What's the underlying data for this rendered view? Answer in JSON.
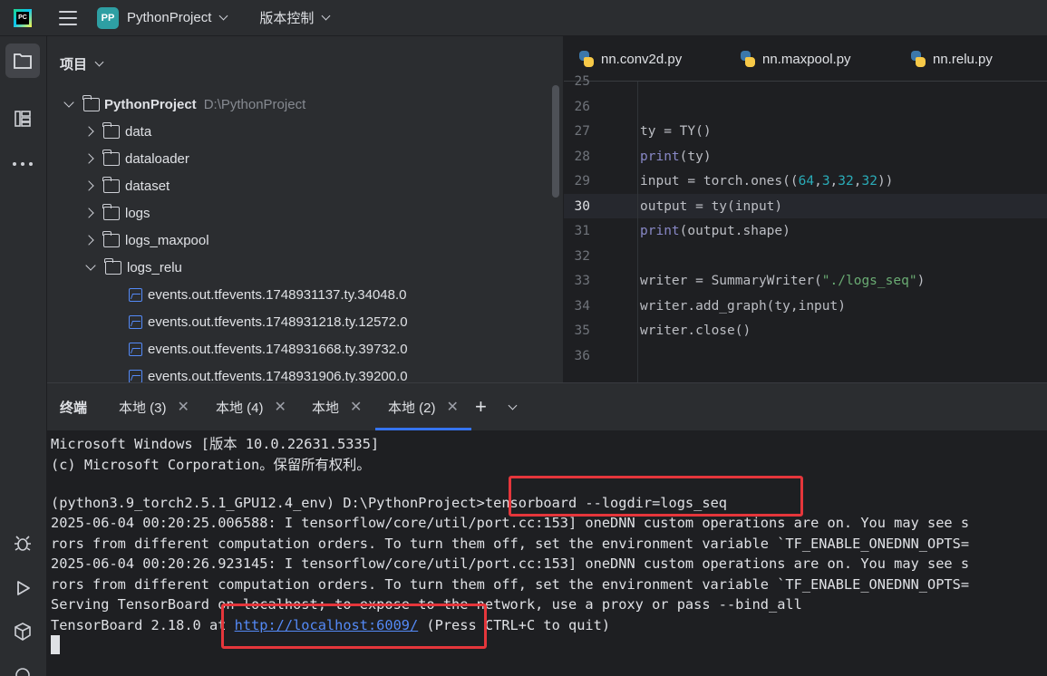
{
  "titlebar": {
    "logo_text": "PC",
    "project_badge": "PP",
    "project_name": "PythonProject",
    "vcs_label": "版本控制"
  },
  "project_panel": {
    "title": "项目",
    "root": {
      "name": "PythonProject",
      "path": "D:\\PythonProject"
    },
    "folders": [
      "data",
      "dataloader",
      "dataset",
      "logs",
      "logs_maxpool",
      "logs_relu"
    ],
    "files": [
      "events.out.tfevents.1748931137.ty.34048.0",
      "events.out.tfevents.1748931218.ty.12572.0",
      "events.out.tfevents.1748931668.ty.39732.0",
      "events.out.tfevents.1748931906.ty.39200.0"
    ]
  },
  "editor": {
    "tabs": [
      "nn.conv2d.py",
      "nn.maxpool.py",
      "nn.relu.py"
    ],
    "line_numbers": [
      "25",
      "26",
      "27",
      "28",
      "29",
      "30",
      "31",
      "32",
      "33",
      "34",
      "35",
      "36"
    ],
    "current_line": "30",
    "code": {
      "l27": "ty = TY()",
      "l28_fn": "print",
      "l28_rest": "(ty)",
      "l29_a": "input = torch.ones((",
      "l29_n1": "64",
      "l29_n2": "3",
      "l29_n3": "32",
      "l29_n4": "32",
      "l29_close": "))",
      "l30": "output = ty(input)",
      "l31_fn": "print",
      "l31_rest": "(output.shape)",
      "l33_a": "writer = SummaryWriter(",
      "l33_str": "\"./logs_seq\"",
      "l33_close": ")",
      "l34": "writer.add_graph(ty,input)",
      "l35": "writer.close()"
    }
  },
  "terminal": {
    "title": "终端",
    "tabs": [
      "本地 (3)",
      "本地 (4)",
      "本地",
      "本地 (2)"
    ],
    "selected_tab": "本地 (2)",
    "add_label": "+",
    "lines": {
      "l1": "Microsoft Windows [版本 10.0.22631.5335]",
      "l2": "(c) Microsoft Corporation。保留所有权利。",
      "l3_prompt": "(python3.9_torch2.5.1_GPU12.4_env) D:\\PythonProject>",
      "l3_cmd": "tensorboard --logdir=logs_seq",
      "l4": "2025-06-04 00:20:25.006588: I tensorflow/core/util/port.cc:153] oneDNN custom operations are on. You may see s",
      "l5": "rors from different computation orders. To turn them off, set the environment variable `TF_ENABLE_ONEDNN_OPTS=",
      "l6": "2025-06-04 00:20:26.923145: I tensorflow/core/util/port.cc:153] oneDNN custom operations are on. You may see s",
      "l7": "rors from different computation orders. To turn them off, set the environment variable `TF_ENABLE_ONEDNN_OPTS=",
      "l8": "Serving TensorBoard on localhost; to expose to the network, use a proxy or pass --bind_all",
      "l9_a": "TensorBoard 2.18.0 at ",
      "l9_link": "http://localhost:6009/",
      "l9_b": " (Press CTRL+C to quit)"
    }
  },
  "colors": {
    "accent": "#3574f0",
    "highlight_box": "#e5363b"
  }
}
